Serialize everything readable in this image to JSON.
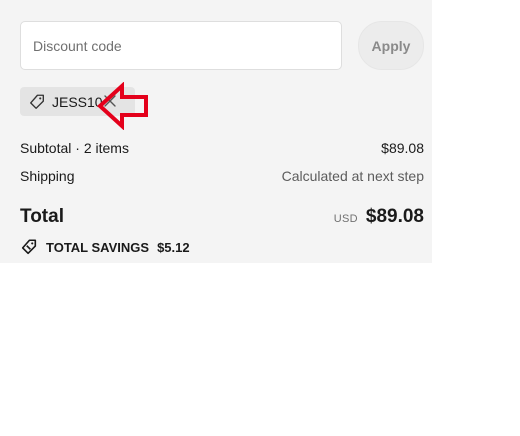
{
  "discount": {
    "placeholder": "Discount code",
    "apply_label": "Apply",
    "applied_code": "JESS10"
  },
  "summary": {
    "subtotal_label": "Subtotal · 2 items",
    "subtotal_value": "$89.08",
    "shipping_label": "Shipping",
    "shipping_value": "Calculated at next step",
    "total_label": "Total",
    "currency": "USD",
    "total_value": "$89.08",
    "savings_label": "TOTAL SAVINGS",
    "savings_value": "$5.12"
  },
  "annotation": {
    "arrow_color": "#e4001b",
    "arrow_icon": "red-arrow-pointing-left"
  }
}
